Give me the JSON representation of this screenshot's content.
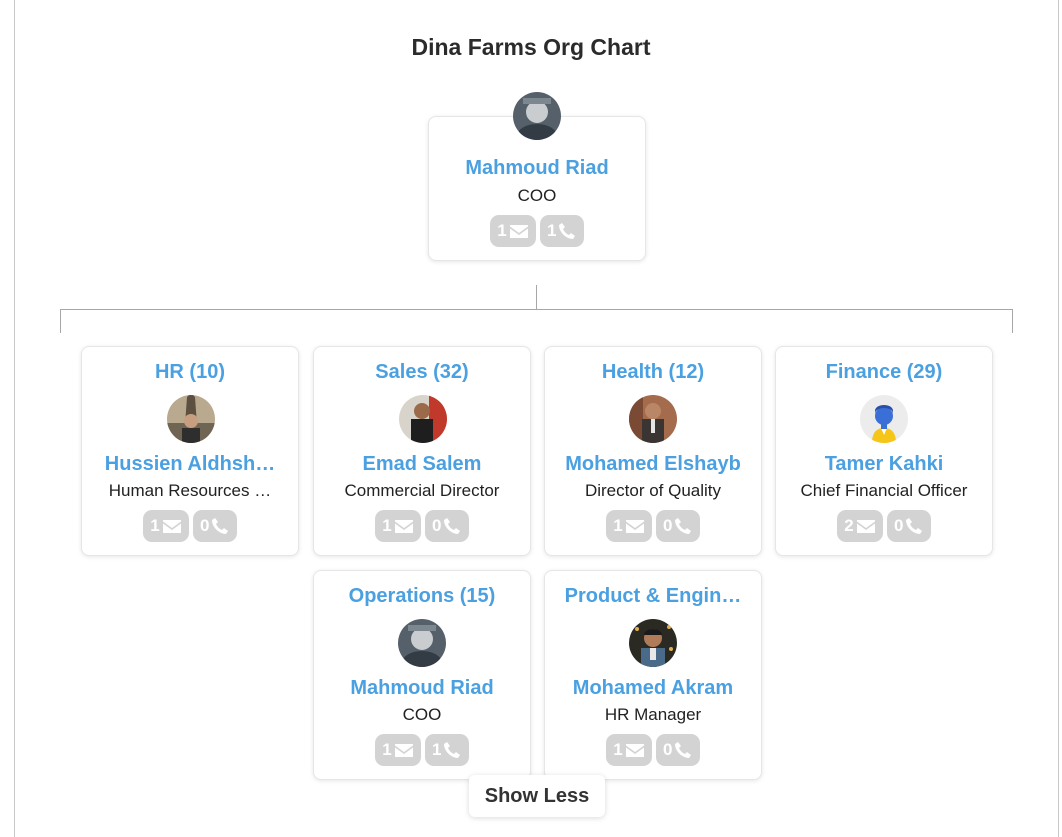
{
  "title": "Dina Farms Org Chart",
  "root": {
    "name": "Mahmoud Riad",
    "role": "COO",
    "emails": "1",
    "phones": "1"
  },
  "departments": [
    {
      "dept": "HR (10)",
      "name": "Hussien Aldhsh…",
      "role": "Human Resources …",
      "emails": "1",
      "phones": "0"
    },
    {
      "dept": "Sales (32)",
      "name": "Emad Salem",
      "role": "Commercial Director",
      "emails": "1",
      "phones": "0"
    },
    {
      "dept": "Health (12)",
      "name": "Mohamed Elshayb",
      "role": "Director of Quality",
      "emails": "1",
      "phones": "0"
    },
    {
      "dept": "Finance (29)",
      "name": "Tamer Kahki",
      "role": "Chief Financial Officer",
      "emails": "2",
      "phones": "0"
    },
    {
      "dept": "Operations (15)",
      "name": "Mahmoud Riad",
      "role": "COO",
      "emails": "1",
      "phones": "1"
    },
    {
      "dept": "Product & Engin…",
      "name": "Mohamed Akram",
      "role": "HR Manager",
      "emails": "1",
      "phones": "0"
    }
  ],
  "show_less_label": "Show Less",
  "colors": {
    "accent": "#4aa0e0",
    "pill": "#d3d3d3",
    "connector": "#a7a7a7"
  },
  "icons": {
    "email": "envelope-icon",
    "phone": "phone-icon",
    "placeholder_avatar": "user-placeholder-icon"
  }
}
